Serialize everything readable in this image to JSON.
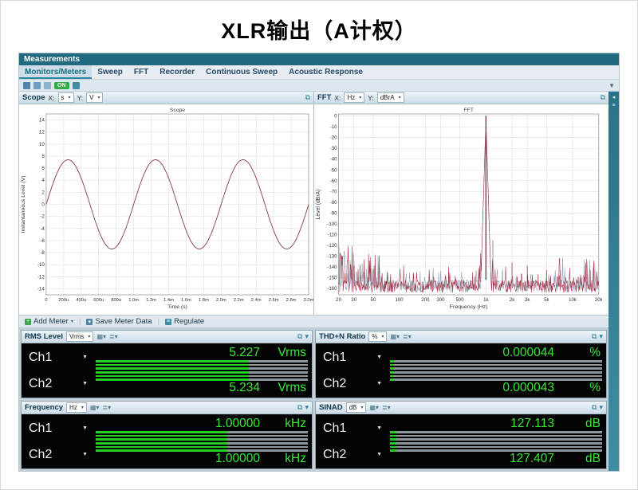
{
  "page": {
    "title": "XLR输出（A计权）"
  },
  "app": {
    "header": {
      "title": "Measurements"
    },
    "tabs": [
      {
        "label": "Monitors/Meters",
        "selected": true
      },
      {
        "label": "Sweep"
      },
      {
        "label": "FFT"
      },
      {
        "label": "Recorder"
      },
      {
        "label": "Continuous Sweep"
      },
      {
        "label": "Acoustic Response"
      }
    ],
    "mini_toolbar": {
      "on_label": "ON"
    }
  },
  "scope_panel": {
    "title": "Scope",
    "x_prefix": "X:",
    "x_unit": "s",
    "y_prefix": "Y:",
    "y_unit": "V",
    "chart": {
      "type": "line",
      "title": "Scope",
      "xlabel": "Time (s)",
      "ylabel": "Instantaneous Level (V)",
      "x_ticks": [
        "0",
        "200u",
        "400u",
        "600u",
        "800u",
        "1.0m",
        "1.2m",
        "1.4m",
        "1.6m",
        "1.8m",
        "2.0m",
        "2.2m",
        "2.4m",
        "2.6m",
        "2.8m",
        "3.0m"
      ],
      "y_ticks": [
        14,
        12,
        10,
        8,
        6,
        4,
        2,
        0,
        -2,
        -4,
        -6,
        -8,
        -10,
        -12,
        -14
      ],
      "ylim": [
        -15,
        15
      ],
      "signal": {
        "shape": "sine",
        "amplitude_v": 7.4,
        "frequency_hz": 1000,
        "duration_s": 0.003
      },
      "color": "#8c3b44",
      "grid": true
    }
  },
  "fft_panel": {
    "title": "FFT",
    "x_prefix": "X:",
    "x_unit": "Hz",
    "y_prefix": "Y:",
    "y_unit": "dBrA",
    "chart": {
      "type": "line",
      "title": "FFT",
      "xlabel": "Frequency (Hz)",
      "ylabel": "Level (dBrA)",
      "x_ticks": [
        {
          "label": "20",
          "hz": 20
        },
        {
          "label": "30",
          "hz": 30
        },
        {
          "label": "50",
          "hz": 50
        },
        {
          "label": "100",
          "hz": 100
        },
        {
          "label": "200",
          "hz": 200
        },
        {
          "label": "300",
          "hz": 300
        },
        {
          "label": "500",
          "hz": 500
        },
        {
          "label": "1k",
          "hz": 1000
        },
        {
          "label": "2k",
          "hz": 2000
        },
        {
          "label": "3k",
          "hz": 3000
        },
        {
          "label": "5k",
          "hz": 5000
        },
        {
          "label": "10k",
          "hz": 10000
        },
        {
          "label": "20k",
          "hz": 20000
        }
      ],
      "y_ticks": [
        0,
        -10,
        -20,
        -30,
        -40,
        -50,
        -60,
        -70,
        -80,
        -90,
        -100,
        -110,
        -120,
        -130,
        -140,
        -150,
        -160
      ],
      "xlim_hz": [
        20,
        20000
      ],
      "ylim_top": 2,
      "ylim_bottom": -166,
      "fundamental": {
        "freq_hz": 1000,
        "level_db": 0
      },
      "harmonics": [
        {
          "freq_hz": 2000,
          "level_db": -136
        },
        {
          "freq_hz": 3000,
          "level_db": -139
        },
        {
          "freq_hz": 4000,
          "level_db": -147
        },
        {
          "freq_hz": 5000,
          "level_db": -143
        },
        {
          "freq_hz": 7000,
          "level_db": -148
        }
      ],
      "noise_floor_db": -152,
      "color_ch1": "#a03040",
      "color_ch2": "#8e9ab8",
      "grid": true
    }
  },
  "meter_toolbar": {
    "add_meter_label": "Add Meter",
    "save_meter_data_label": "Save Meter Data",
    "regulate_label": "Regulate"
  },
  "meters": [
    {
      "name": "RMS Level",
      "unit": "Vrms",
      "channels": [
        {
          "label": "Ch1",
          "value": "5.227",
          "unit": "Vrms",
          "fill": 0.72
        },
        {
          "label": "Ch2",
          "value": "5.234",
          "unit": "Vrms",
          "fill": 0.72
        }
      ]
    },
    {
      "name": "THD+N Ratio",
      "unit": "%",
      "channels": [
        {
          "label": "Ch1",
          "value": "0.000044",
          "unit": "%",
          "fill": 0.02
        },
        {
          "label": "Ch2",
          "value": "0.000043",
          "unit": "%",
          "fill": 0.02
        }
      ]
    },
    {
      "name": "Frequency",
      "unit": "Hz",
      "channels": [
        {
          "label": "Ch1",
          "value": "1.00000",
          "unit": "kHz",
          "fill": 0.62
        },
        {
          "label": "Ch2",
          "value": "1.00000",
          "unit": "kHz",
          "fill": 0.62
        }
      ]
    },
    {
      "name": "SINAD",
      "unit": "dB",
      "channels": [
        {
          "label": "Ch1",
          "value": "127.113",
          "unit": "dB",
          "fill": 0.03
        },
        {
          "label": "Ch2",
          "value": "127.407",
          "unit": "dB",
          "fill": 0.03
        }
      ]
    }
  ]
}
